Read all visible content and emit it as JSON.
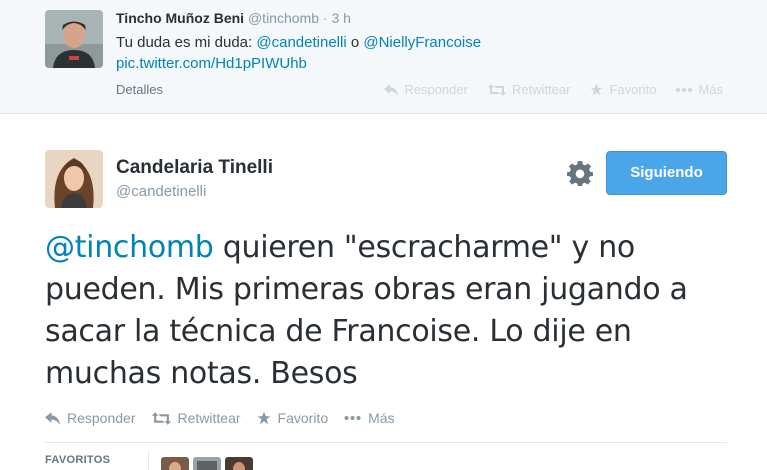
{
  "parent_tweet": {
    "fullname": "Tincho Muñoz Beni",
    "handle": "@tinchomb",
    "separator": "·",
    "time": "3 h",
    "text_prefix": "Tu duda es mi duda: ",
    "mention1": "@candetinelli",
    "text_or": " o ",
    "mention2": "@NiellyFrancoise",
    "link": "pic.twitter.com/Hd1pPIWUhb",
    "details_label": "Detalles",
    "actions": {
      "reply": "Responder",
      "retweet": "Retwittear",
      "favorite": "Favorito",
      "more": "Más"
    }
  },
  "main_tweet": {
    "fullname": "Candelaria Tinelli",
    "handle": "@candetinelli",
    "follow_label": "Siguiendo",
    "text_mention": "@tinchomb",
    "text_body": " quieren \"escracharme\" y no pueden. Mis primeras obras eran jugando a sacar la técnica de Francoise. Lo dije en muchas notas. Besos",
    "actions": {
      "reply": "Responder",
      "retweet": "Retwittear",
      "favorite": "Favorito",
      "more": "Más"
    },
    "stats_label": "FAVORITOS"
  },
  "colors": {
    "link": "#0084b4",
    "button": "#4aa6e8",
    "muted": "#8899a6",
    "parent_bg": "#f5f8fa"
  }
}
